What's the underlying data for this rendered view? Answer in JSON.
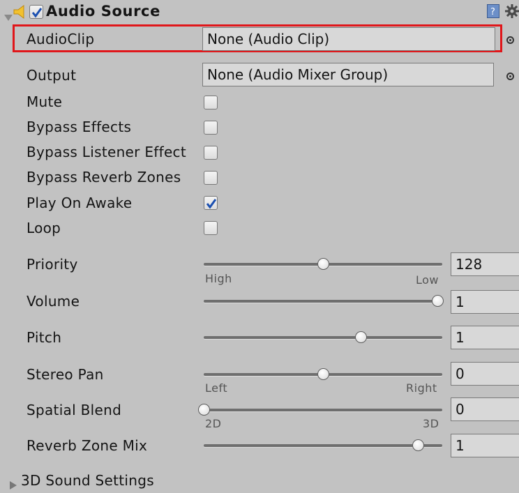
{
  "header": {
    "title": "Audio Source",
    "enabled": true,
    "icons": [
      "foldout-arrow-icon",
      "speaker-icon",
      "help-icon",
      "gear-icon"
    ]
  },
  "audio_clip": {
    "label": "AudioClip",
    "value": "None (Audio Clip)",
    "highlight_color": "#e0161a"
  },
  "output": {
    "label": "Output",
    "value": "None (Audio Mixer Group)"
  },
  "toggles": [
    {
      "label": "Mute",
      "checked": false
    },
    {
      "label": "Bypass Effects",
      "checked": false
    },
    {
      "label": "Bypass Listener Effect",
      "checked": false
    },
    {
      "label": "Bypass Reverb Zones",
      "checked": false
    },
    {
      "label": "Play On Awake",
      "checked": true
    },
    {
      "label": "Loop",
      "checked": false
    }
  ],
  "sliders": [
    {
      "label": "Priority",
      "value": "128",
      "fraction": 0.5,
      "min_label": "High",
      "max_label": "Low"
    },
    {
      "label": "Volume",
      "value": "1",
      "fraction": 1.0
    },
    {
      "label": "Pitch",
      "value": "1",
      "fraction": 0.66
    },
    {
      "label": "Stereo Pan",
      "value": "0",
      "fraction": 0.5,
      "min_label": "Left",
      "max_label": "Right"
    },
    {
      "label": "Spatial Blend",
      "value": "0",
      "fraction": 0.0,
      "min_label": "2D",
      "max_label": "3D"
    },
    {
      "label": "Reverb Zone Mix",
      "value": "1",
      "fraction": 0.9
    }
  ],
  "footer": {
    "label": "3D Sound Settings"
  },
  "colors": {
    "background": "#c2c2c2",
    "check_mark": "#1a4fb0"
  }
}
